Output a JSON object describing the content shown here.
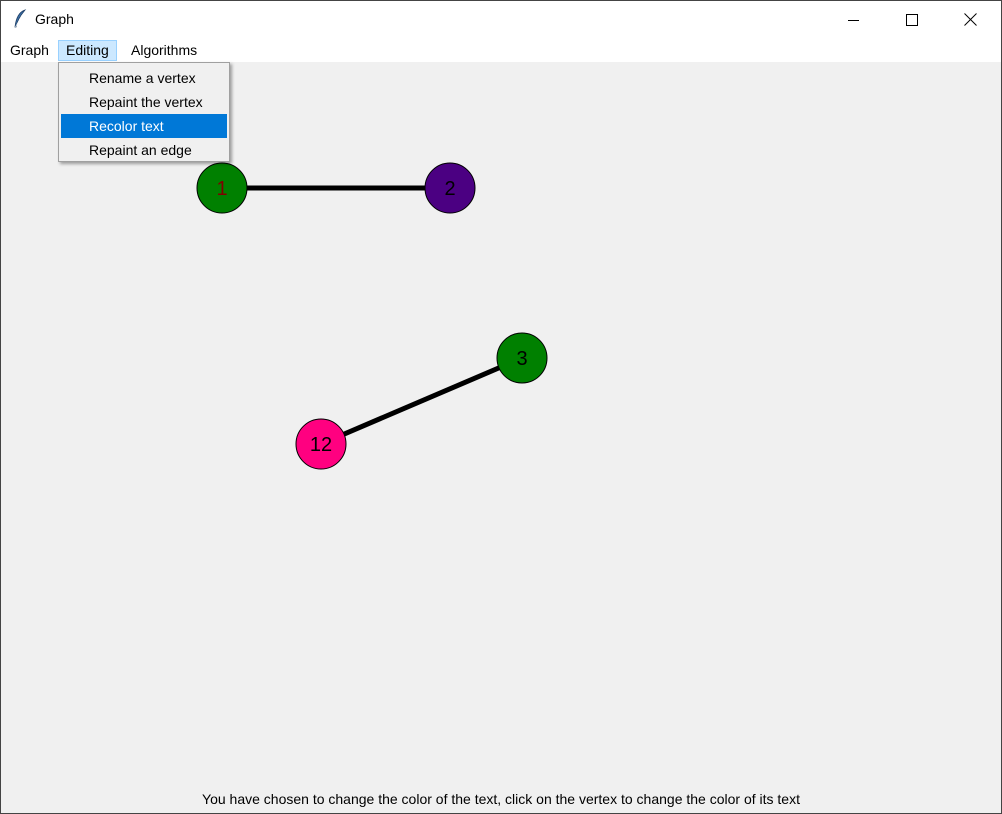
{
  "window": {
    "title": "Graph",
    "controls": [
      "minimize-icon",
      "maximize-icon",
      "close-icon"
    ]
  },
  "menubar": {
    "items": [
      {
        "label": "Graph"
      },
      {
        "label": "Editing",
        "active": true
      },
      {
        "label": "Algorithms"
      }
    ]
  },
  "editing_menu": {
    "items": [
      {
        "label": "Rename a vertex"
      },
      {
        "label": "Repaint the vertex"
      },
      {
        "label": "Recolor text",
        "highlighted": true
      },
      {
        "label": "Repaint an edge"
      }
    ]
  },
  "graph": {
    "vertices": [
      {
        "id": "1",
        "label": "1",
        "fill": "#008000",
        "text_color": "#800000"
      },
      {
        "id": "2",
        "label": "2",
        "fill": "#4b0082",
        "text_color": "#000000"
      },
      {
        "id": "3",
        "label": "3",
        "fill": "#008000",
        "text_color": "#000000"
      },
      {
        "id": "12",
        "label": "12",
        "fill": "#ff0080",
        "text_color": "#000000"
      }
    ],
    "edges": [
      {
        "from": "1",
        "to": "2",
        "color": "#000000"
      },
      {
        "from": "12",
        "to": "3",
        "color": "#000000"
      }
    ]
  },
  "status": {
    "text": "You have chosen to change the color of the text, click on the vertex to change the color of its text"
  },
  "colors": {
    "menu_highlight": "#0078d7",
    "menu_active": "#cce8ff",
    "canvas_bg": "#f0f0f0"
  }
}
